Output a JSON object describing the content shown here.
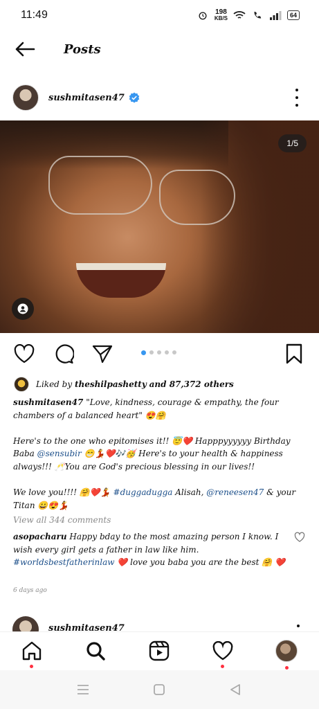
{
  "status_bar": {
    "time": "11:49",
    "speed_value": "198",
    "speed_unit": "KB/S",
    "battery": "64"
  },
  "header": {
    "title": "Posts"
  },
  "post": {
    "username": "sushmitasen47",
    "counter": "1/5",
    "liked_by_prefix": "Liked by",
    "liked_by_user": "theshilpashetty",
    "liked_by_suffix": "and 87,372 others",
    "caption_user": "sushmitasen47",
    "caption_line1": "\"Love, kindness, courage & empathy, the four chambers of a balanced heart\" 😍🤗",
    "caption_p2_a": "Here's to the one who epitomises it!! 😇❤️ Happpyyyyyy Birthday Baba ",
    "caption_p2_mention": "@sensubir",
    "caption_p2_b": " 😁💃❤️🎶🥳 Here's to your health & happiness always!!! 🥂You are God's precious blessing in our lives!!",
    "caption_p3_a": "We love you!!!! 🤗❤️💃 ",
    "caption_p3_tag": "#duggadugga",
    "caption_p3_b": "  Alisah, ",
    "caption_p3_mention": "@reneesen47",
    "caption_p3_c": " & your Titan 😀😍💃",
    "view_comments": "View all 344 comments",
    "comment_user": "asopacharu",
    "comment_text_a": " Happy bday to the most amazing person I know.  I wish every girl gets a father in law like him. ",
    "comment_tag": "#worldsbestfatherinlaw",
    "comment_text_b": " ❤️ love you baba you are the best 🤗 ❤️",
    "timestamp": "6 days ago"
  },
  "next_post": {
    "username": "sushmitasen47"
  },
  "colors": {
    "accent_blue": "#3897f0",
    "notification_red": "#ff3040",
    "link_blue": "#1c4f8a"
  },
  "icons": {
    "back": "arrow-left-icon",
    "verified": "verified-badge-icon",
    "more": "more-vertical-icon",
    "tag": "person-tag-icon",
    "like": "heart-icon",
    "comment": "comment-icon",
    "share": "send-icon",
    "save": "bookmark-icon",
    "home": "home-icon",
    "search": "search-icon",
    "reels": "reels-icon",
    "activity": "heart-icon",
    "profile": "profile-avatar"
  }
}
